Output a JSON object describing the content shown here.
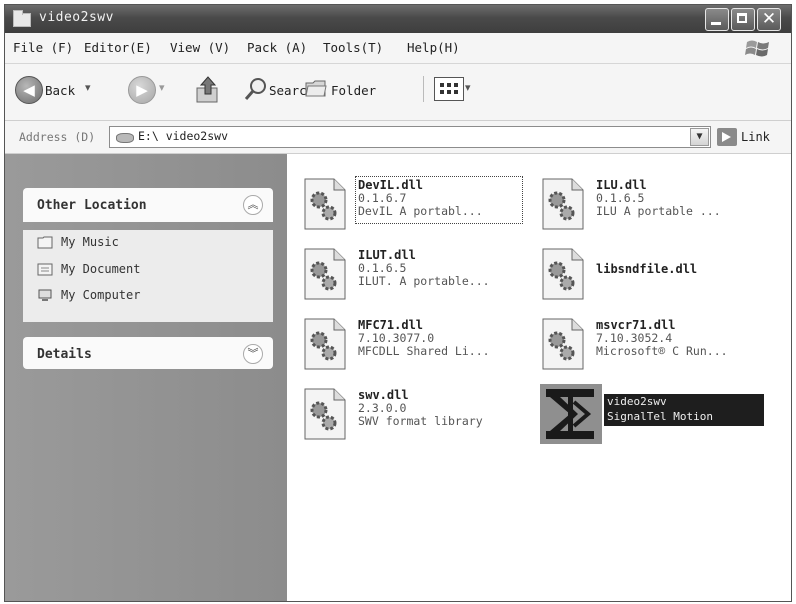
{
  "window": {
    "title": "video2swv"
  },
  "menu": [
    "File (F)",
    "Editor(E)",
    "View (V)",
    "Pack (A)",
    "Tools(T)",
    "Help(H)"
  ],
  "toolbar": {
    "back_label": "Back",
    "search_label": "Search",
    "folders_label": "Folder"
  },
  "address": {
    "label": "Address (D)",
    "path": "E:\\ video2swv",
    "go_label": "Link"
  },
  "left_pane": {
    "other_location": {
      "title": "Other Location",
      "items": [
        {
          "label": "My Music",
          "icon": "folder-icon"
        },
        {
          "label": "My Document",
          "icon": "documents-icon"
        },
        {
          "label": "My Computer",
          "icon": "computer-icon"
        }
      ]
    },
    "details": {
      "title": "Details"
    }
  },
  "files": [
    {
      "name": "DevIL.dll",
      "version": "0.1.6.7",
      "desc": "DevIL  A portabl...",
      "icon": "dll-gear-icon",
      "focused": true
    },
    {
      "name": "ILU.dll",
      "version": "0.1.6.5",
      "desc": "ILU  A portable ...",
      "icon": "dll-gear-icon"
    },
    {
      "name": "ILUT.dll",
      "version": "0.1.6.5",
      "desc": "ILUT. A portable...",
      "icon": "dll-gear-icon"
    },
    {
      "name": "libsndfile.dll",
      "icon": "dll-gear-icon"
    },
    {
      "name": "MFC71.dll",
      "version": "7.10.3077.0",
      "desc": "MFCDLL Shared Li...",
      "icon": "dll-gear-icon"
    },
    {
      "name": "msvcr71.dll",
      "version": "7.10.3052.4",
      "desc": "Microsoft® C Run...",
      "icon": "dll-gear-icon"
    },
    {
      "name": "swv.dll",
      "version": "2.3.0.0",
      "desc": "SWV format library",
      "icon": "dll-gear-icon"
    },
    {
      "name": "video2swv",
      "desc": "SignalTel Motion",
      "icon": "app-logo-icon",
      "selected": true
    }
  ]
}
